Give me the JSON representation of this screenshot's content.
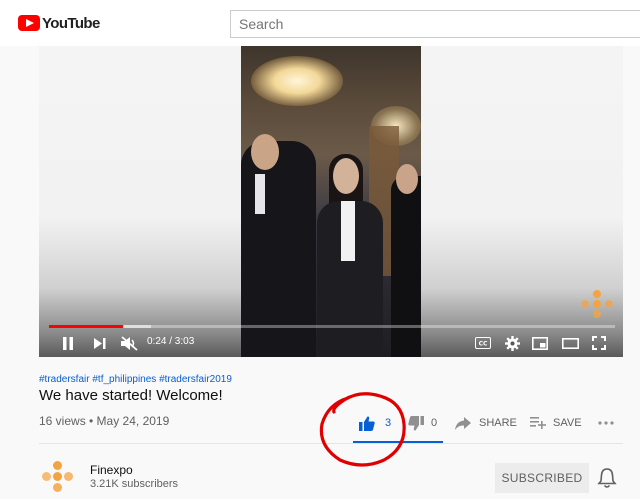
{
  "header": {
    "logo_text": "YouTube",
    "search_placeholder": "Search"
  },
  "player": {
    "current_time": "0:24",
    "duration": "3:03",
    "time_display": "0:24 / 3:03",
    "played_fraction": 0.13,
    "buffered_fraction": 0.18,
    "muted": true,
    "icons": [
      "pause-icon",
      "next-icon",
      "mute-icon",
      "cc-icon",
      "settings-icon",
      "miniplayer-icon",
      "theater-icon",
      "fullscreen-icon"
    ]
  },
  "video": {
    "hashtags": "#tradersfair #tf_philippines #tradersfair2019",
    "title": "We have started! Welcome!",
    "meta": "16 views • May 24, 2019"
  },
  "actions": {
    "like_count": "3",
    "dislike_count": "0",
    "share_label": "SHARE",
    "save_label": "SAVE"
  },
  "channel": {
    "name": "Finexpo",
    "subscribers": "3.21K subscribers",
    "subscribe_label": "SUBSCRIBED"
  },
  "colors": {
    "brand_red": "#ff0000",
    "link_blue": "#065fd4",
    "annotation_red": "#e00000",
    "finexpo_orange": "#f5a340"
  }
}
